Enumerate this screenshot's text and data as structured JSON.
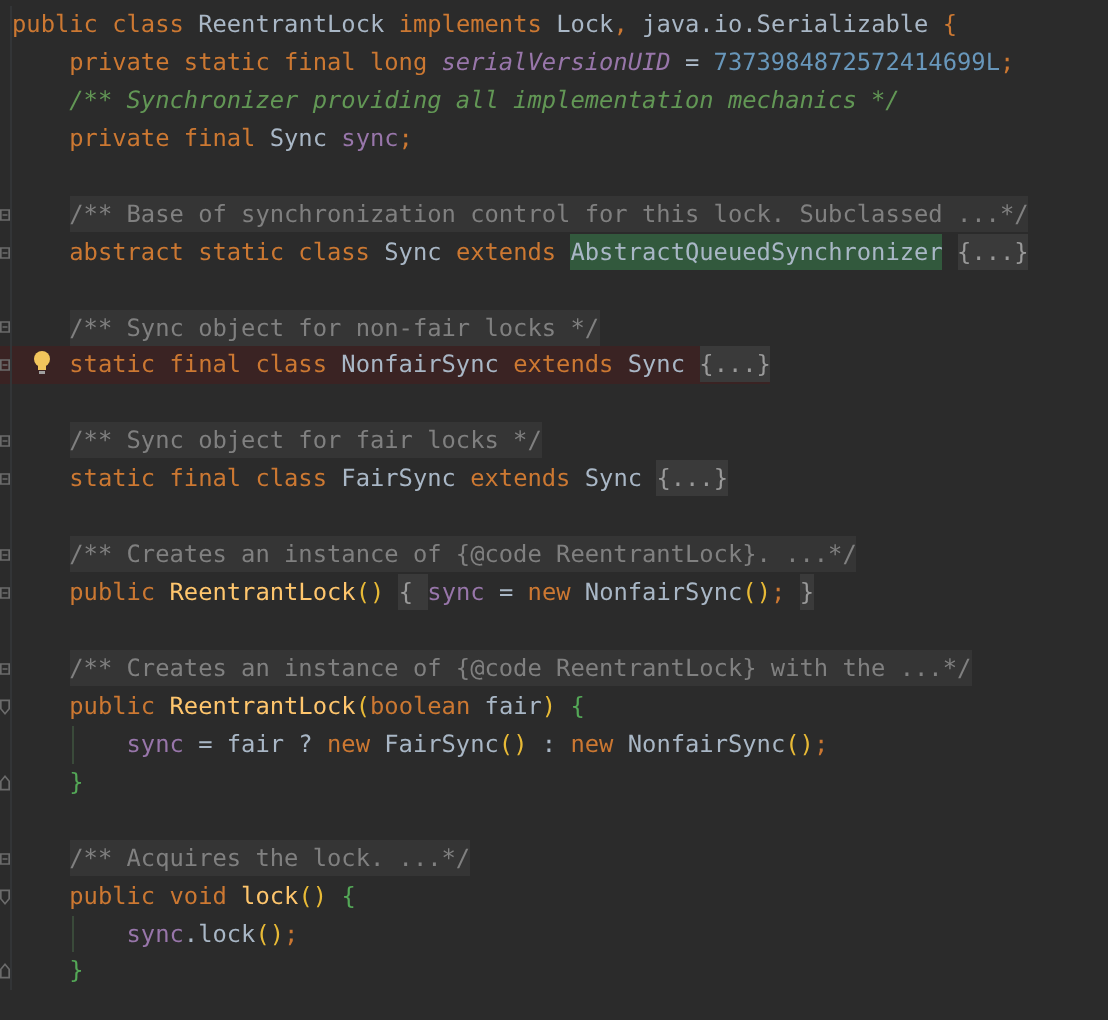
{
  "editor": {
    "lines": [
      {
        "kind": "code",
        "tokens": [
          {
            "kind": "kw",
            "text": "public class "
          },
          {
            "kind": "cls",
            "text": "ReentrantLock "
          },
          {
            "kind": "kw",
            "text": "implements "
          },
          {
            "kind": "cls",
            "text": "Lock"
          },
          {
            "kind": "kw",
            "text": ", "
          },
          {
            "kind": "cls",
            "text": "java.io.Serializable "
          },
          {
            "kind": "kw",
            "text": "{"
          }
        ]
      },
      {
        "kind": "code",
        "tokens": [
          {
            "kind": "kw",
            "text": "    private static final long "
          },
          {
            "kind": "sfield",
            "text": "serialVersionUID"
          },
          {
            "kind": "cls",
            "text": " = "
          },
          {
            "kind": "num",
            "text": "7373984872572414699L"
          },
          {
            "kind": "kw",
            "text": ";"
          }
        ]
      },
      {
        "kind": "code",
        "tokens": [
          {
            "kind": "comment",
            "text": "    /** Synchronizer providing all implementation mechanics */"
          }
        ]
      },
      {
        "kind": "code",
        "tokens": [
          {
            "kind": "kw",
            "text": "    private final "
          },
          {
            "kind": "cls",
            "text": "Sync "
          },
          {
            "kind": "field",
            "text": "sync"
          },
          {
            "kind": "kw",
            "text": ";"
          }
        ]
      },
      {
        "kind": "blank"
      },
      {
        "kind": "code",
        "marker": {
          "kind": "collapsed"
        },
        "tokens": [
          {
            "kind": "doc",
            "text": "    /** Base of synchronization control for this lock. Subclassed ...*/"
          }
        ]
      },
      {
        "kind": "code",
        "marker": {
          "kind": "collapsed"
        },
        "tokens": [
          {
            "kind": "kw",
            "text": "    abstract static class "
          },
          {
            "kind": "cls",
            "text": "Sync "
          },
          {
            "kind": "kw",
            "text": "extends "
          },
          {
            "kind": "match",
            "text": "AbstractQueuedSynchronizer"
          },
          {
            "kind": "fold",
            "text": " {...}"
          }
        ]
      },
      {
        "kind": "blank"
      },
      {
        "kind": "code",
        "marker": {
          "kind": "collapsed"
        },
        "tokens": [
          {
            "kind": "doc",
            "text": "    /** Sync object for non-fair locks */"
          }
        ]
      },
      {
        "kind": "code",
        "marker": {
          "kind": "collapsed"
        },
        "highlighted": true,
        "bulb": true,
        "tokens": [
          {
            "kind": "kw",
            "text": "    static final class "
          },
          {
            "kind": "cls",
            "text": "NonfairSync "
          },
          {
            "kind": "kw",
            "text": "extends "
          },
          {
            "kind": "cls",
            "text": "Sync"
          },
          {
            "kind": "fold",
            "text": " {...}"
          }
        ]
      },
      {
        "kind": "blank"
      },
      {
        "kind": "code",
        "marker": {
          "kind": "collapsed"
        },
        "tokens": [
          {
            "kind": "doc",
            "text": "    /** Sync object for fair locks */"
          }
        ]
      },
      {
        "kind": "code",
        "marker": {
          "kind": "collapsed"
        },
        "tokens": [
          {
            "kind": "kw",
            "text": "    static final class "
          },
          {
            "kind": "cls",
            "text": "FairSync "
          },
          {
            "kind": "kw",
            "text": "extends "
          },
          {
            "kind": "cls",
            "text": "Sync"
          },
          {
            "kind": "fold",
            "text": " {...}"
          }
        ]
      },
      {
        "kind": "blank"
      },
      {
        "kind": "code",
        "marker": {
          "kind": "collapsed"
        },
        "tokens": [
          {
            "kind": "doc",
            "text": "    /** Creates an instance of {@code ReentrantLock}. ...*/"
          }
        ]
      },
      {
        "kind": "code",
        "marker": {
          "kind": "collapsed"
        },
        "tokens": [
          {
            "kind": "kw",
            "text": "    public "
          },
          {
            "kind": "method",
            "text": "ReentrantLock"
          },
          {
            "kind": "paren",
            "text": "()"
          },
          {
            "kind": "fold",
            "text": " { "
          },
          {
            "kind": "field",
            "text": "sync"
          },
          {
            "kind": "cls",
            "text": " = "
          },
          {
            "kind": "kw",
            "text": "new "
          },
          {
            "kind": "cls",
            "text": "NonfairSync"
          },
          {
            "kind": "paren",
            "text": "()"
          },
          {
            "kind": "kw",
            "text": ";"
          },
          {
            "kind": "fold",
            "text": " }"
          }
        ]
      },
      {
        "kind": "blank"
      },
      {
        "kind": "code",
        "marker": {
          "kind": "collapsed"
        },
        "tokens": [
          {
            "kind": "doc",
            "text": "    /** Creates an instance of {@code ReentrantLock} with the ...*/"
          }
        ]
      },
      {
        "kind": "code",
        "marker": {
          "kind": "start"
        },
        "tokens": [
          {
            "kind": "kw",
            "text": "    public "
          },
          {
            "kind": "method",
            "text": "ReentrantLock"
          },
          {
            "kind": "paren",
            "text": "("
          },
          {
            "kind": "kw",
            "text": "boolean "
          },
          {
            "kind": "cls",
            "text": "fair"
          },
          {
            "kind": "paren",
            "text": ")"
          },
          {
            "kind": "brace",
            "text": " {"
          }
        ]
      },
      {
        "kind": "code",
        "guide": true,
        "tokens": [
          {
            "kind": "field",
            "text": "        sync"
          },
          {
            "kind": "cls",
            "text": " = fair ? "
          },
          {
            "kind": "kw",
            "text": "new "
          },
          {
            "kind": "cls",
            "text": "FairSync"
          },
          {
            "kind": "paren",
            "text": "()"
          },
          {
            "kind": "cls",
            "text": " : "
          },
          {
            "kind": "kw",
            "text": "new "
          },
          {
            "kind": "cls",
            "text": "NonfairSync"
          },
          {
            "kind": "paren",
            "text": "()"
          },
          {
            "kind": "kw",
            "text": ";"
          }
        ]
      },
      {
        "kind": "code",
        "marker": {
          "kind": "end"
        },
        "tokens": [
          {
            "kind": "brace",
            "text": "    }"
          }
        ]
      },
      {
        "kind": "blank"
      },
      {
        "kind": "code",
        "marker": {
          "kind": "collapsed"
        },
        "tokens": [
          {
            "kind": "doc",
            "text": "    /** Acquires the lock. ...*/"
          }
        ]
      },
      {
        "kind": "code",
        "marker": {
          "kind": "start"
        },
        "tokens": [
          {
            "kind": "kw",
            "text": "    public void "
          },
          {
            "kind": "method",
            "text": "lock"
          },
          {
            "kind": "paren",
            "text": "()"
          },
          {
            "kind": "brace",
            "text": " {"
          }
        ]
      },
      {
        "kind": "code",
        "guide": true,
        "tokens": [
          {
            "kind": "field",
            "text": "        sync"
          },
          {
            "kind": "cls",
            "text": ".lock"
          },
          {
            "kind": "paren",
            "text": "()"
          },
          {
            "kind": "kw",
            "text": ";"
          }
        ]
      },
      {
        "kind": "code",
        "marker": {
          "kind": "end"
        },
        "tokens": [
          {
            "kind": "brace",
            "text": "    }"
          }
        ]
      }
    ]
  }
}
